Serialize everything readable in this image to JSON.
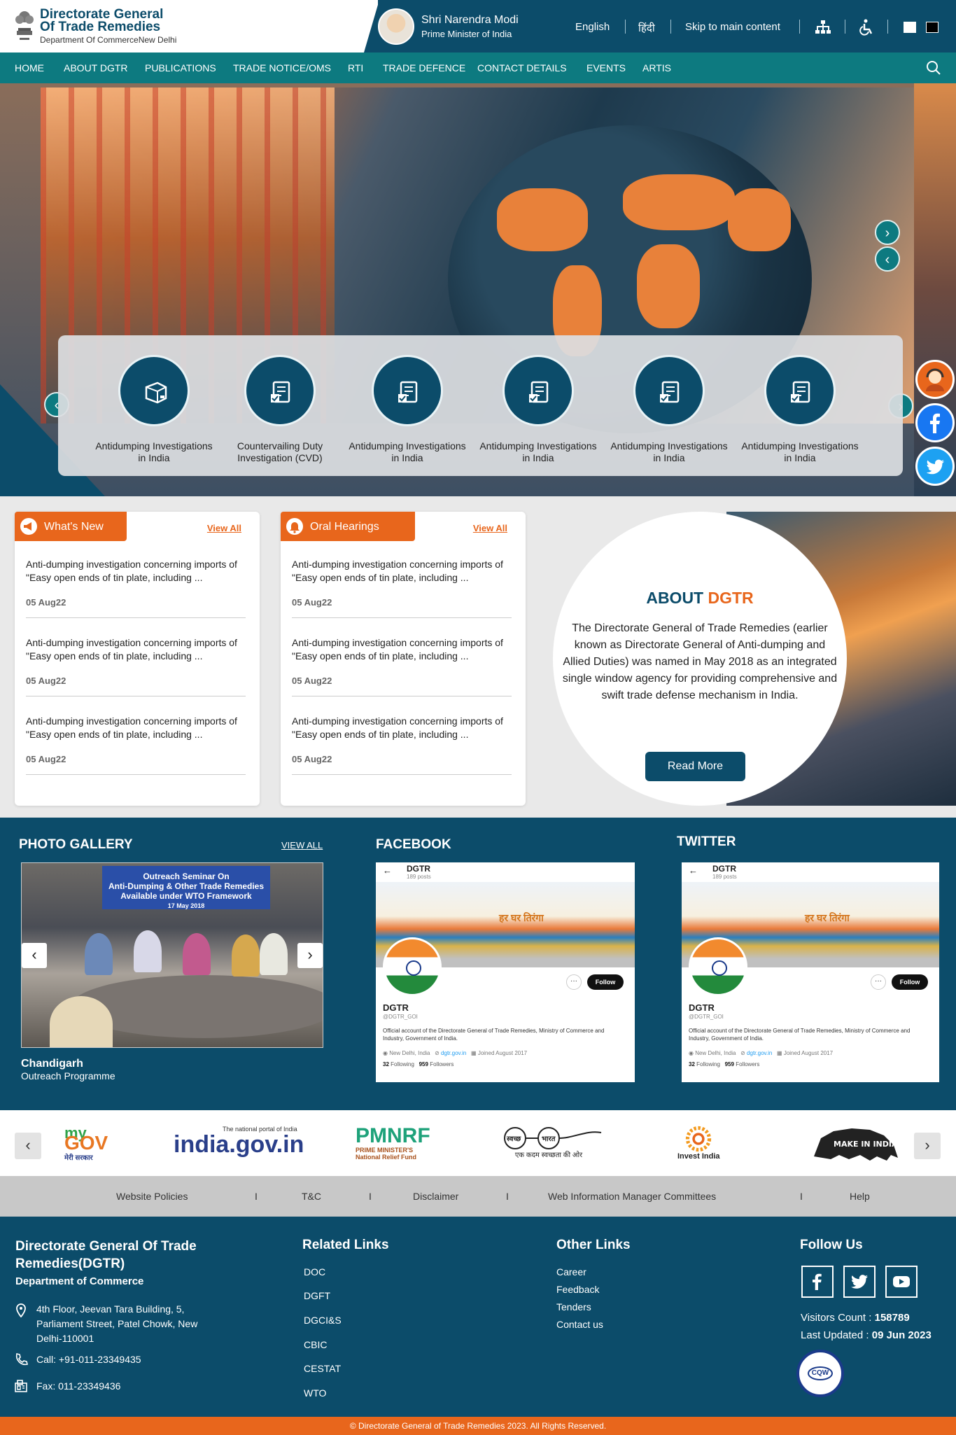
{
  "header": {
    "org_line1": "Directorate General",
    "org_line2": "Of Trade Remedies",
    "org_sub": "Department Of CommerceNew Delhi",
    "pm_name": "Shri Narendra Modi",
    "pm_title": "Prime Minister of India",
    "lang_en": "English",
    "lang_hi": "हिंदी",
    "skip": "Skip to main content"
  },
  "nav": {
    "items": [
      "HOME",
      "ABOUT DGTR",
      "PUBLICATIONS",
      "TRADE NOTICE/OMS",
      "RTI",
      "TRADE DEFENCE",
      "CONTACT DETAILS",
      "EVENTS",
      "ARTIS"
    ]
  },
  "services": [
    {
      "label": "Antidumping Investigations in India",
      "icon": "box-icon"
    },
    {
      "label": "Countervailing Duty Investigation (CVD)",
      "icon": "document-check-icon"
    },
    {
      "label": "Antidumping Investigations in India",
      "icon": "document-check-icon"
    },
    {
      "label": "Antidumping Investigations in India",
      "icon": "document-check-icon"
    },
    {
      "label": "Antidumping Investigations in India",
      "icon": "document-check-icon"
    },
    {
      "label": "Antidumping Investigations in India",
      "icon": "document-check-icon"
    }
  ],
  "whats_new": {
    "title": "What's New",
    "view_all": "View All",
    "items": [
      {
        "text": "Anti-dumping investigation concerning imports of \"Easy open ends of tin plate, including ...",
        "date": "05 Aug22"
      },
      {
        "text": "Anti-dumping investigation concerning imports of \"Easy open ends of tin plate, including ...",
        "date": "05 Aug22"
      },
      {
        "text": "Anti-dumping investigation concerning imports of \"Easy open ends of tin plate, including ...",
        "date": "05 Aug22"
      }
    ]
  },
  "oral_hearings": {
    "title": "Oral Hearings",
    "view_all": "View All",
    "items": [
      {
        "text": "Anti-dumping investigation concerning imports of \"Easy open ends of tin plate, including ...",
        "date": "05 Aug22"
      },
      {
        "text": "Anti-dumping investigation concerning imports of \"Easy open ends of tin plate, including ...",
        "date": "05 Aug22"
      },
      {
        "text": "Anti-dumping investigation concerning imports of \"Easy open ends of tin plate, including ...",
        "date": "05 Aug22"
      }
    ]
  },
  "about": {
    "title_a": "ABOUT",
    "title_b": "DGTR",
    "text": "The Directorate General of Trade Remedies (earlier known as Directorate General of Anti-dumping and Allied Duties) was named in May 2018 as an integrated single window agency for providing comprehensive and swift trade defense mechanism in India.",
    "button": "Read More"
  },
  "gallery": {
    "title": "PHOTO GALLERY",
    "view_all": "VIEW ALL",
    "banner_line1": "Outreach Seminar On",
    "banner_line2": "Anti-Dumping & Other Trade Remedies",
    "banner_line3": "Available under WTO Framework",
    "banner_date": "17 May 2018",
    "caption_title": "Chandigarh",
    "caption_sub": "Outreach Programme"
  },
  "facebook": {
    "title": "FACEBOOK",
    "name": "DGTR",
    "posts": "189 posts",
    "handle": "@DGTR_GOI",
    "bio": "Official account of the Directorate General of Trade Remedies, Ministry of Commerce and Industry, Government of India.",
    "location": "New Delhi, India",
    "link": "dgtr.gov.in",
    "joined": "Joined August 2017",
    "following": "32",
    "following_label": "Following",
    "followers": "959",
    "followers_label": "Followers",
    "follow_btn": "Follow",
    "banner_text": "हर घर तिरंगा"
  },
  "twitter": {
    "title": "TWITTER",
    "name": "DGTR",
    "posts": "189 posts",
    "handle": "@DGTR_GOI",
    "bio": "Official account of the Directorate General of Trade Remedies, Ministry of Commerce and Industry, Government of India.",
    "location": "New Delhi, India",
    "link": "dgtr.gov.in",
    "joined": "Joined August 2017",
    "following": "32",
    "following_label": "Following",
    "followers": "959",
    "followers_label": "Followers",
    "follow_btn": "Follow",
    "banner_text": "हर घर तिरंगा"
  },
  "partners": {
    "mygov_a": "my",
    "mygov_b": "GOV",
    "mygov_c": "मेरी सरकार",
    "indiagov_tag": "The national portal of India",
    "indiagov": "india.gov.in",
    "pmnrf": "PMNRF",
    "pmnrf_sub1": "PRIME MINISTER'S",
    "pmnrf_sub2": "National Relief Fund",
    "swachh_a": "स्वच्छ",
    "swachh_b": "भारत",
    "swachh_sub": "एक कदम स्वच्छता की ओर",
    "invest": "Invest India",
    "makeinindia": "MAKE IN INDIA"
  },
  "footer_links": [
    "Website Policies",
    "T&C",
    "Disclaimer",
    "Web Information Manager Committees",
    "Help"
  ],
  "footer": {
    "org": "Directorate General Of Trade Remedies(DGTR)",
    "dept": "Department of Commerce",
    "address": "4th Floor, Jeevan Tara Building, 5, Parliament Street, Patel Chowk, New Delhi-110001",
    "call": "Call: +91-011-23349435",
    "fax": "Fax: 011-23349436",
    "related_title": "Related Links",
    "related": [
      "DOC",
      "DGFT",
      "DGCI&S",
      "CBIC",
      "CESTAT",
      "WTO"
    ],
    "other_title": "Other Links",
    "other": [
      "Career",
      "Feedback",
      "Tenders",
      "Contact us"
    ],
    "follow_title": "Follow Us",
    "visitors_label": "Visitors Count : ",
    "visitors": "158789",
    "updated_label": "Last Updated : ",
    "updated": "09 Jun 2023",
    "cqw": "CQW"
  },
  "copyright": "© Directorate General of Trade Remedies 2023. All Rights Reserved.",
  "colors": {
    "primary": "#0c4c6a",
    "teal": "#0d7a80",
    "accent": "#e8661c"
  }
}
